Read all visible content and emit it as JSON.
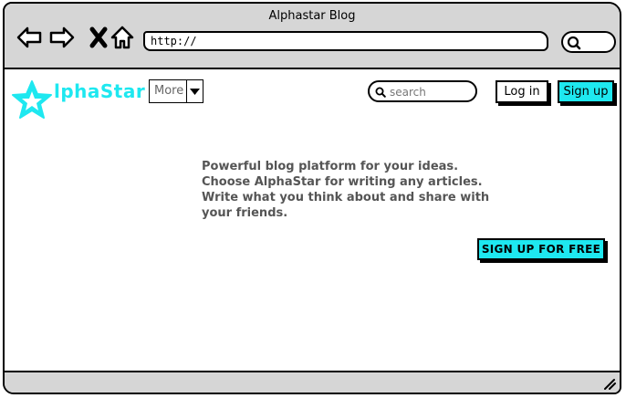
{
  "window": {
    "title": "Alphastar Blog"
  },
  "browser": {
    "url": "http://",
    "icons": [
      "back-icon",
      "forward-icon",
      "close-icon",
      "home-icon",
      "search-icon"
    ]
  },
  "site": {
    "logo_text": "lphaStar",
    "more_label": "More",
    "search_placeholder": "search",
    "login_label": "Log in",
    "signup_label": "Sign up",
    "accent_color": "#1ee8f0"
  },
  "content": {
    "intro_lines": [
      "Powerful blog platform for your ideas.",
      "Choose AlphaStar for writing any articles.",
      "Write what you think about and share with",
      "your friends."
    ],
    "cta_label": "SIGN UP FOR FREE"
  }
}
